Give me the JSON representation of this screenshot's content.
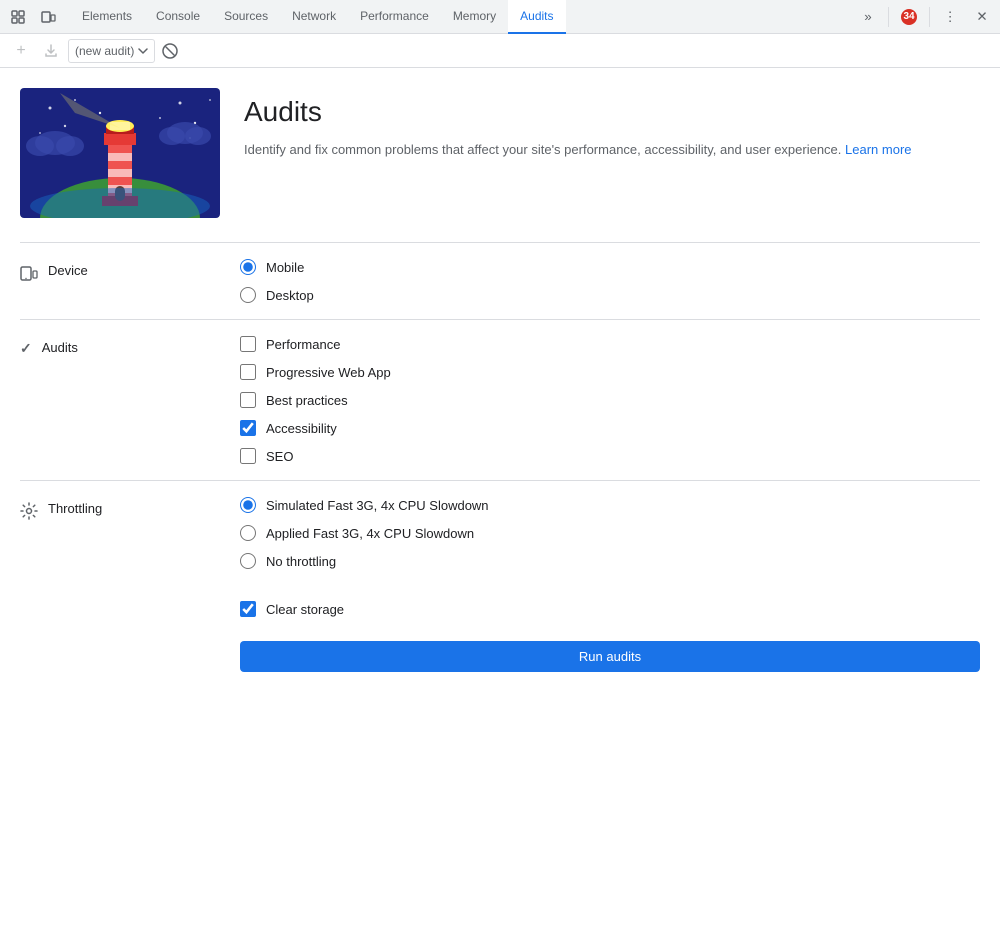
{
  "tabbar": {
    "tabs": [
      {
        "id": "elements",
        "label": "Elements",
        "active": false
      },
      {
        "id": "console",
        "label": "Console",
        "active": false
      },
      {
        "id": "sources",
        "label": "Sources",
        "active": false
      },
      {
        "id": "network",
        "label": "Network",
        "active": false
      },
      {
        "id": "performance",
        "label": "Performance",
        "active": false
      },
      {
        "id": "memory",
        "label": "Memory",
        "active": false
      },
      {
        "id": "audits",
        "label": "Audits",
        "active": true
      }
    ],
    "more_label": "»",
    "error_count": "34",
    "more_tools_label": "⋮",
    "close_label": "✕"
  },
  "toolbar": {
    "new_audit_placeholder": "(new audit)",
    "stop_title": "Stop"
  },
  "hero": {
    "title": "Audits",
    "description": "Identify and fix common problems that affect your site's performance, accessibility, and user experience.",
    "learn_more_label": "Learn more",
    "learn_more_href": "#"
  },
  "device_section": {
    "icon": "device",
    "label": "Device",
    "options": [
      {
        "id": "mobile",
        "label": "Mobile",
        "checked": true
      },
      {
        "id": "desktop",
        "label": "Desktop",
        "checked": false
      }
    ]
  },
  "audits_section": {
    "icon": "checkmark",
    "label": "Audits",
    "options": [
      {
        "id": "performance",
        "label": "Performance",
        "checked": false
      },
      {
        "id": "pwa",
        "label": "Progressive Web App",
        "checked": false
      },
      {
        "id": "best-practices",
        "label": "Best practices",
        "checked": false
      },
      {
        "id": "accessibility",
        "label": "Accessibility",
        "checked": true
      },
      {
        "id": "seo",
        "label": "SEO",
        "checked": false
      }
    ]
  },
  "throttling_section": {
    "icon": "gear",
    "label": "Throttling",
    "options": [
      {
        "id": "simulated-fast-3g",
        "label": "Simulated Fast 3G, 4x CPU Slowdown",
        "checked": true
      },
      {
        "id": "applied-fast-3g",
        "label": "Applied Fast 3G, 4x CPU Slowdown",
        "checked": false
      },
      {
        "id": "no-throttling",
        "label": "No throttling",
        "checked": false
      }
    ]
  },
  "storage": {
    "label": "Clear storage",
    "checked": true
  },
  "run_button": {
    "label": "Run audits"
  }
}
